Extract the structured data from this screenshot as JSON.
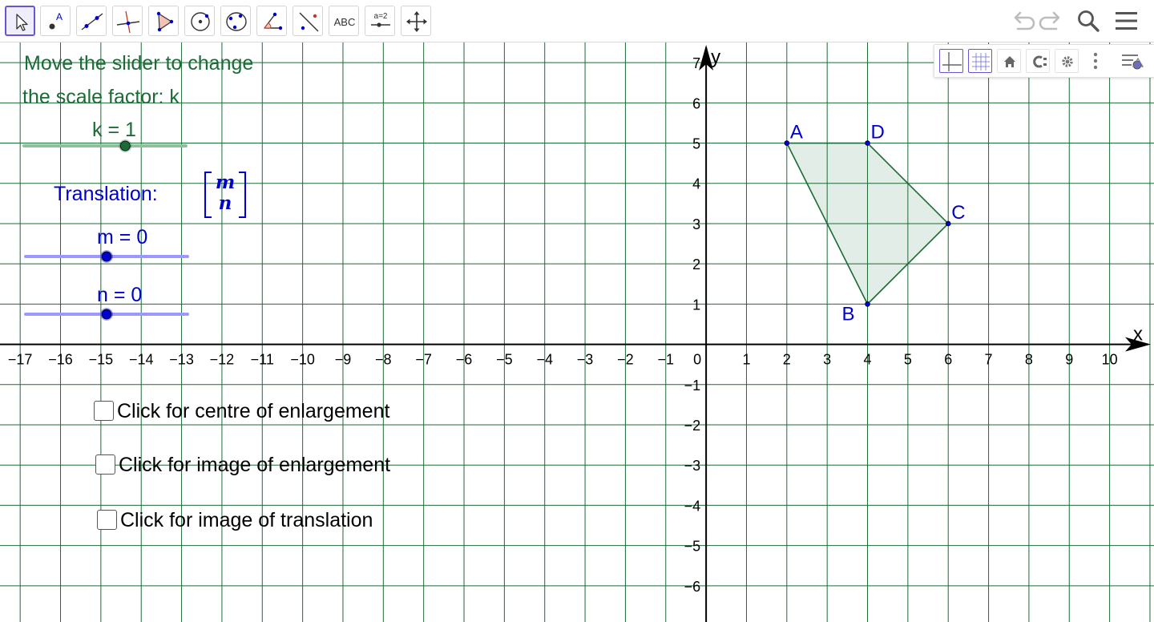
{
  "toolbar": {
    "tools": [
      {
        "id": "move",
        "icon": "arrow-pointer-icon",
        "active": true
      },
      {
        "id": "point",
        "icon": "point-icon",
        "active": false
      },
      {
        "id": "line",
        "icon": "line-icon",
        "active": false
      },
      {
        "id": "perpendicular",
        "icon": "perpendicular-line-icon",
        "active": false
      },
      {
        "id": "polygon",
        "icon": "polygon-icon",
        "active": false
      },
      {
        "id": "circle-center",
        "icon": "circle-center-point-icon",
        "active": false
      },
      {
        "id": "circle-three",
        "icon": "circle-three-points-icon",
        "active": false
      },
      {
        "id": "angle",
        "icon": "angle-icon",
        "active": false
      },
      {
        "id": "reflect",
        "icon": "reflect-line-icon",
        "active": false
      },
      {
        "id": "text",
        "icon": "text-icon",
        "active": false
      },
      {
        "id": "slider",
        "icon": "slider-icon",
        "active": false
      },
      {
        "id": "move-view",
        "icon": "move-graphics-view-icon",
        "active": false
      }
    ],
    "text_tool_label": "ABC",
    "slider_tool_label": "a=2",
    "right_icons": [
      "undo-icon",
      "redo-icon",
      "search-icon",
      "menu-icon"
    ]
  },
  "style_bar": {
    "buttons": [
      "axes-icon",
      "grid-icon",
      "home-icon",
      "label-style-icon",
      "settings-icon",
      "more-vertical-icon",
      "style-bar-toggle-icon"
    ]
  },
  "instructions": {
    "line1": "Move the slider to change",
    "line2": "the scale factor: k"
  },
  "sliders": {
    "k": {
      "label": "k = 1",
      "value": 1,
      "min": -4,
      "max": 4,
      "color": "#1b6b36",
      "track_color": "#8fbf9c"
    },
    "m": {
      "label": "m = 0",
      "value": 0,
      "min": -10,
      "max": 10,
      "color": "#0000cc",
      "track_color": "#9999ff"
    },
    "n": {
      "label": "n = 0",
      "value": 0,
      "min": -10,
      "max": 10,
      "color": "#0000cc",
      "track_color": "#9999ff"
    }
  },
  "translation": {
    "label": "Translation:",
    "vector_top": "m",
    "vector_bottom": "n"
  },
  "checkboxes": [
    {
      "label": "Click for centre of enlargement",
      "checked": false
    },
    {
      "label": "Click for image of enlargement",
      "checked": false
    },
    {
      "label": "Click for image of translation",
      "checked": false
    }
  ],
  "graph": {
    "x_axis_label": "x",
    "y_axis_label": "y",
    "x_range": [
      -17.5,
      11.1
    ],
    "y_range": [
      -6.9,
      7.5
    ],
    "x_tick_min": -17,
    "x_tick_max": 10,
    "y_tick_min": -6,
    "y_tick_max": 7,
    "origin_label": "0",
    "grid": true,
    "grid_color": "#1b6b36",
    "polygon_fill": "#1b6b36",
    "point_color": "#0000cc",
    "points": [
      {
        "name": "A",
        "x": 2,
        "y": 5
      },
      {
        "name": "B",
        "x": 4,
        "y": 1
      },
      {
        "name": "C",
        "x": 6,
        "y": 3
      },
      {
        "name": "D",
        "x": 4,
        "y": 5
      }
    ],
    "polygon_order": [
      "A",
      "D",
      "C",
      "B"
    ]
  }
}
